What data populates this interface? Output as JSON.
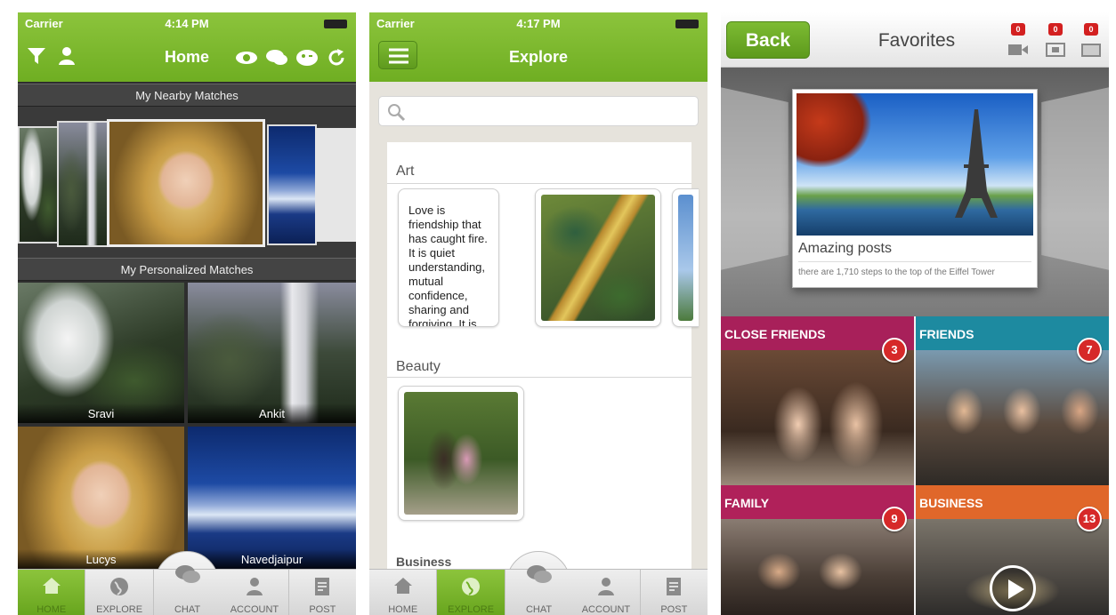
{
  "screen_home": {
    "status": {
      "carrier": "Carrier",
      "time": "4:14 PM"
    },
    "title": "Home",
    "nearby_label": "My Nearby Matches",
    "personalized_label": "My Personalized Matches",
    "matches": [
      {
        "name": "Sravi"
      },
      {
        "name": "Ankit"
      },
      {
        "name": "Lucys"
      },
      {
        "name": "Navedjaipur"
      }
    ],
    "tabs": [
      {
        "label": "HOME",
        "icon": "home-icon",
        "active": true
      },
      {
        "label": "EXPLORE",
        "icon": "globe-icon",
        "active": false
      },
      {
        "label": "CHAT",
        "icon": "chat-icon",
        "active": false
      },
      {
        "label": "ACCOUNT",
        "icon": "account-icon",
        "active": false
      },
      {
        "label": "POST",
        "icon": "post-icon",
        "active": false
      }
    ]
  },
  "screen_explore": {
    "status": {
      "carrier": "Carrier",
      "time": "4:17 PM"
    },
    "title": "Explore",
    "search": {
      "placeholder": ""
    },
    "categories": [
      {
        "label": "Art",
        "quote": "Love is friendship that has caught fire. It is quiet understanding, mutual confidence, sharing and forgiving. It is"
      },
      {
        "label": "Beauty"
      },
      {
        "label": "Business"
      }
    ],
    "tabs": [
      {
        "label": "HOME",
        "icon": "home-icon",
        "active": false
      },
      {
        "label": "EXPLORE",
        "icon": "globe-icon",
        "active": true
      },
      {
        "label": "CHAT",
        "icon": "chat-icon",
        "active": false
      },
      {
        "label": "ACCOUNT",
        "icon": "account-icon",
        "active": false
      },
      {
        "label": "POST",
        "icon": "post-icon",
        "active": false
      }
    ]
  },
  "screen_favorites": {
    "back_label": "Back",
    "title": "Favorites",
    "header_badges": [
      "0",
      "0",
      "0"
    ],
    "featured": {
      "title": "Amazing posts",
      "subtitle": "there are 1,710 steps to the top of the Eiffel Tower"
    },
    "groups": [
      {
        "label": "CLOSE FRIENDS",
        "count": "3",
        "color": "#a8205a"
      },
      {
        "label": "FRIENDS",
        "count": "7",
        "color": "#1d8aa0"
      },
      {
        "label": "FAMILY",
        "count": "9",
        "color": "#b0215a"
      },
      {
        "label": "BUSINESS",
        "count": "13",
        "color": "#e0672a"
      }
    ]
  },
  "colors": {
    "accent_green": "#79b52b",
    "badge_red": "#d62929"
  }
}
